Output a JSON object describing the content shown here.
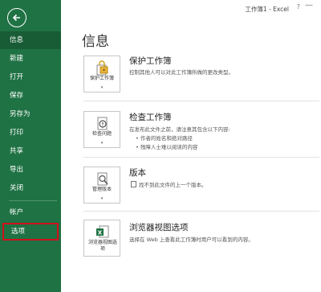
{
  "window": {
    "title": "工作簿1 - Excel",
    "help": "?",
    "minimize": "—"
  },
  "sidebar": {
    "items": [
      {
        "label": "信息"
      },
      {
        "label": "新建"
      },
      {
        "label": "打开"
      },
      {
        "label": "保存"
      },
      {
        "label": "另存为"
      },
      {
        "label": "打印"
      },
      {
        "label": "共享"
      },
      {
        "label": "导出"
      },
      {
        "label": "关闭"
      },
      {
        "label": "帐户"
      },
      {
        "label": "选项"
      }
    ]
  },
  "main": {
    "title": "信息",
    "sections": [
      {
        "button": "保护工作簿",
        "title": "保护工作簿",
        "desc": "控制其他人可以对此工作簿所做的更改类型。"
      },
      {
        "button": "检查问题",
        "title": "检查工作簿",
        "desc": "在发布此文件之前，请注意其包含以下内容:",
        "bullets": [
          "作者的姓名和绝对路径",
          "残障人士难以阅读的内容"
        ]
      },
      {
        "button": "管理版本",
        "title": "版本",
        "desc": "找不到此文件的上一个版本。"
      },
      {
        "button": "浏览器视图选项",
        "title": "浏览器视图选项",
        "desc": "选择在 Web 上查看此工作簿时用户可以看到的内容。"
      }
    ]
  },
  "colors": {
    "sidebar": "#1f7244",
    "active": "#185c36",
    "highlight_border": "#d0101b"
  }
}
